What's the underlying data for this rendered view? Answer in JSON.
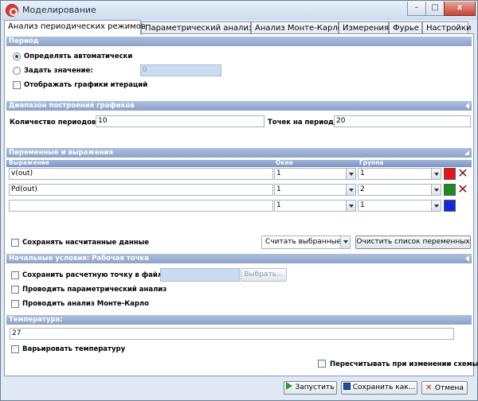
{
  "window": {
    "title": "Моделирование",
    "controls": {
      "minimize": "–",
      "maximize": "□",
      "close": "x"
    }
  },
  "tabs": [
    {
      "label": "Анализ периодических режимов",
      "active": true
    },
    {
      "label": "Параметрический анализ"
    },
    {
      "label": "Анализ Монте-Карло"
    },
    {
      "label": "Измерения"
    },
    {
      "label": "Фурье"
    },
    {
      "label": "Настройки"
    }
  ],
  "period": {
    "header": "Период",
    "auto_label": "Определять автоматически",
    "value_label": "Задать значение:",
    "value": "0",
    "show_iterations_label": "Отображать графики итераций"
  },
  "plot_range": {
    "header": "Диапазон построения графиков",
    "periods_label": "Количество периодов:",
    "periods_value": "10",
    "points_label": "Точек на период:",
    "points_value": "20"
  },
  "variables": {
    "header": "Переменные и выражения",
    "columns": [
      "Выражение",
      "Окно",
      "Группа"
    ],
    "rows": [
      {
        "expression": "v(out)",
        "window": "1",
        "group": "1",
        "color": "#e8141b"
      },
      {
        "expression": "Pd(out)",
        "window": "1",
        "group": "2",
        "color": "#1b8a21"
      },
      {
        "expression": "",
        "window": "1",
        "group": "1",
        "color": "#1428e0"
      }
    ],
    "save_label": "Сохранять насчитанные данные",
    "count_select": "Считать выбранные",
    "clear_button": "Очистить список переменных"
  },
  "initial": {
    "header": "Начальные условия: Рабочая точка",
    "save_point_label": "Сохранить расчетную точку в файл",
    "browse_button": "Выбрать...",
    "param_label": "Проводить параметрический анализ",
    "montecarlo_label": "Проводить анализ Монте-Карло"
  },
  "temperature": {
    "header": "Температура:",
    "value": "27",
    "vary_label": "Варьировать температуру"
  },
  "footer": {
    "recalc_label": "Пересчитывать при изменении схемы",
    "run_button": "Запустить",
    "save_button": "Сохранить как...",
    "cancel_button": "Отмена"
  },
  "colors": {
    "header_bg": "#8ca2c8",
    "window_bg": "#dfe8f3",
    "disabled_input": "#c9dcf0"
  }
}
